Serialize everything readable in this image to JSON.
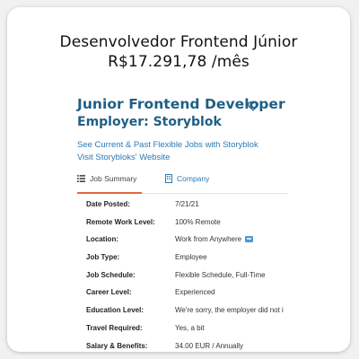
{
  "headline": {
    "title": "Desenvolvedor Frontend Júnior",
    "salary": "R$17.291,78 /mês"
  },
  "job": {
    "title": "Junior Frontend Developer",
    "employer": "Employer: Storyblok",
    "links": [
      "See Current & Past Flexible Jobs with Storyblok",
      "Visit Storybloks' Website"
    ]
  },
  "tabs": [
    {
      "label": "Job Summary",
      "icon": "list-icon",
      "active": true
    },
    {
      "label": "Company",
      "icon": "building-icon",
      "active": false
    }
  ],
  "details": [
    {
      "label": "Date Posted:",
      "value": "7/21/21"
    },
    {
      "label": "Remote Work Level:",
      "value": "100% Remote"
    },
    {
      "label": "Location:",
      "value": "Work from Anywhere"
    },
    {
      "label": "Job Type:",
      "value": "Employee"
    },
    {
      "label": "Job Schedule:",
      "value": "Flexible Schedule, Full-Time"
    },
    {
      "label": "Career Level:",
      "value": "Experienced"
    },
    {
      "label": "Education Level:",
      "value": "We're sorry, the employer did not i"
    },
    {
      "label": "Travel Required:",
      "value": "Yes, a bit"
    },
    {
      "label": "Salary & Benefits:",
      "value": "34.00 EUR / Annually"
    }
  ],
  "colors": {
    "title_blue": "#1f5f85",
    "link_blue": "#2a7ab5",
    "active_tab_underline": "#e0693d"
  }
}
